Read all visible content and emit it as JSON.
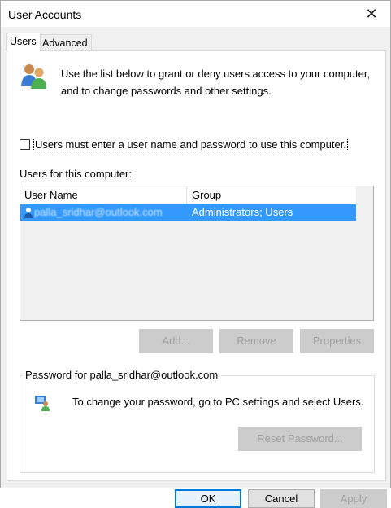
{
  "window": {
    "title": "User Accounts",
    "close_glyph": "✕"
  },
  "tabs": [
    {
      "label": "Users"
    },
    {
      "label": "Advanced"
    }
  ],
  "intro_text": "Use the list below to grant or deny users access to your computer, and to change passwords and other settings.",
  "require_login": {
    "label": "Users must enter a user name and password to use this computer.",
    "checked": false
  },
  "users_section": {
    "label": "Users for this computer:",
    "columns": [
      "User Name",
      "Group"
    ],
    "rows": [
      {
        "name": "palla_sridhar@outlook.com",
        "group": "Administrators; Users",
        "selected": true
      }
    ]
  },
  "list_buttons": {
    "add": "Add...",
    "remove": "Remove",
    "properties": "Properties"
  },
  "password_group": {
    "legend": "Password for palla_sridhar@outlook.com",
    "text": "To change your password, go to PC settings and select Users.",
    "reset_button": "Reset Password..."
  },
  "dialog_buttons": {
    "ok": "OK",
    "cancel": "Cancel",
    "apply": "Apply"
  },
  "icons": {
    "users": "users-icon",
    "row": "user-row-icon",
    "password": "password-icon",
    "close": "close-icon"
  },
  "colors": {
    "selection": "#3399ff",
    "button_face": "#e1e1e1",
    "focus_border": "#0078d7",
    "disabled_text": "#a0a0a0"
  }
}
